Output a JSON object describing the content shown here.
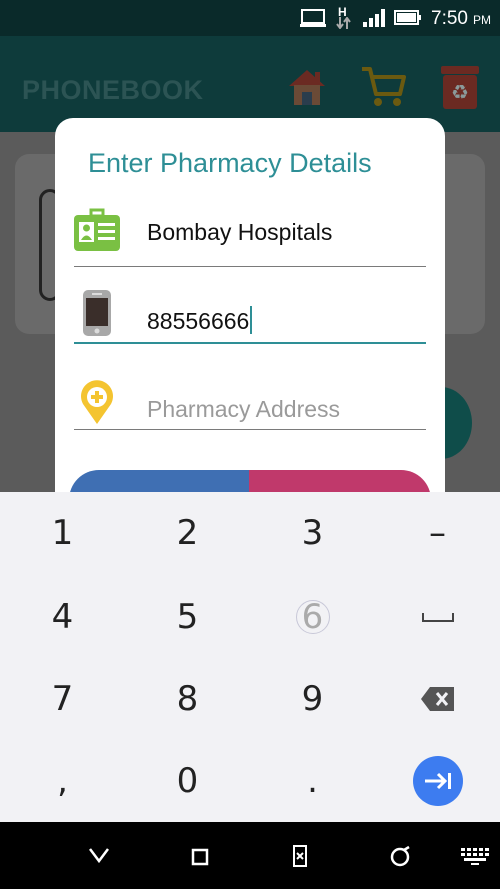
{
  "status_bar": {
    "time": "7:50",
    "ampm": "PM",
    "network": "H"
  },
  "app_bar": {
    "title": "PHONEBOOK",
    "icons": [
      "home-icon",
      "cart-icon",
      "recycle-bin-icon"
    ]
  },
  "dialog": {
    "title": "Enter Pharmacy Details",
    "fields": [
      {
        "icon": "id-card-icon",
        "value": "Bombay Hospitals",
        "placeholder": ""
      },
      {
        "icon": "mobile-phone-icon",
        "value": "88556666",
        "placeholder": ""
      },
      {
        "icon": "location-pin-icon",
        "value": "",
        "placeholder": "Pharmacy Address"
      }
    ]
  },
  "keyboard": {
    "keys": [
      "1",
      "2",
      "3",
      "–",
      "4",
      "5",
      "6",
      "space",
      "7",
      "8",
      "9",
      "backspace",
      ",",
      "0",
      ".",
      "next"
    ]
  },
  "colors": {
    "accent": "#2e8f96",
    "app_bar": "#0e3b3b",
    "button_blue": "#3f6fb3",
    "button_pink": "#c0396b",
    "keyboard_action": "#3d7cf0"
  }
}
